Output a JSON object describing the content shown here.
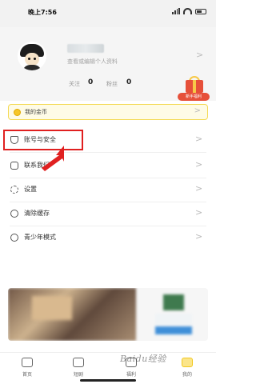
{
  "status_bar": {
    "time": "晚上7:56"
  },
  "profile": {
    "subtitle": "查看或编辑个人资料"
  },
  "stats": {
    "follow_label": "关注",
    "follow_count": "0",
    "fans_label": "粉丝",
    "fans_count": "0"
  },
  "gift": {
    "label": "新手福利"
  },
  "coins": {
    "label": "我的金币"
  },
  "menu": [
    {
      "label": "账号与安全",
      "icon": "shield-icon"
    },
    {
      "label": "联系我们",
      "icon": "chat-icon"
    },
    {
      "label": "设置",
      "icon": "gear-icon"
    },
    {
      "label": "清除缓存",
      "icon": "clean-icon"
    },
    {
      "label": "青少年模式",
      "icon": "teen-icon"
    }
  ],
  "tabbar": [
    {
      "label": "首页",
      "icon": "home-icon"
    },
    {
      "label": "短剧",
      "icon": "tv-icon"
    },
    {
      "label": "福利",
      "icon": "gift-icon"
    },
    {
      "label": "我的",
      "icon": "user-icon"
    }
  ],
  "watermark": "Baidu经验",
  "colors": {
    "highlight": "#e02020",
    "accent": "#f2c81e"
  }
}
